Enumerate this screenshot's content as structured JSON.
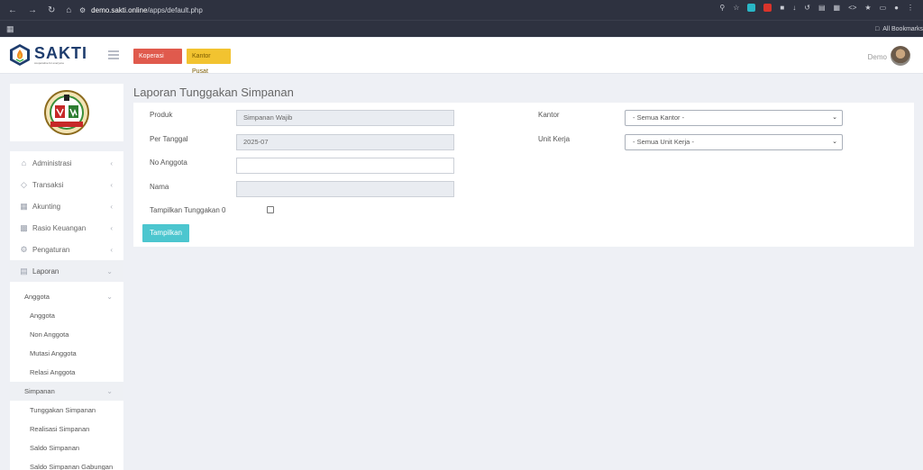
{
  "browser": {
    "url_host": "demo.sakti.online",
    "url_path": "/apps/default.php",
    "bookmarks_label": "All Bookmarks"
  },
  "header": {
    "logo_text": "SAKTI",
    "logo_tagline": "cooperative for everyone",
    "btn_koperasi": "Koperasi Sakti",
    "btn_kantor": "Kantor Pusat",
    "user": "Demo"
  },
  "sidebar": {
    "items": [
      {
        "label": "Administrasi",
        "icon": "home-icon"
      },
      {
        "label": "Transaksi",
        "icon": "diamond-icon"
      },
      {
        "label": "Akunting",
        "icon": "calculator-icon"
      },
      {
        "label": "Rasio Keuangan",
        "icon": "bar-chart-icon"
      },
      {
        "label": "Pengaturan",
        "icon": "gear-icon"
      },
      {
        "label": "Laporan",
        "icon": "book-icon"
      }
    ],
    "laporan_sub": {
      "anggota": "Anggota",
      "anggota_items": [
        "Anggota",
        "Non Anggota",
        "Mutasi Anggota",
        "Relasi Anggota"
      ],
      "simpanan": "Simpanan",
      "simpanan_items": [
        "Tunggakan Simpanan",
        "Realisasi Simpanan",
        "Saldo Simpanan",
        "Saldo Simpanan Gabungan"
      ]
    }
  },
  "page": {
    "title": "Laporan Tunggakan Simpanan"
  },
  "form": {
    "produk_label": "Produk",
    "produk_value": "Simpanan Wajib",
    "per_tanggal_label": "Per Tanggal",
    "per_tanggal_value": "2025-07",
    "no_anggota_label": "No Anggota",
    "no_anggota_value": "",
    "nama_label": "Nama",
    "nama_value": "",
    "tampilkan_nol_label": "Tampilkan Tunggakan 0",
    "tampilkan_nol_checked": false,
    "kantor_label": "Kantor",
    "kantor_value": "- Semua Kantor -",
    "unit_kerja_label": "Unit Kerja",
    "unit_kerja_value": "- Semua Unit Kerja -",
    "submit_label": "Tampilkan"
  },
  "colors": {
    "btn_koperasi": "#e05a4d",
    "btn_kantor": "#f2c330",
    "btn_submit": "#4cc6cf",
    "logo_text": "#1f3d6e"
  }
}
